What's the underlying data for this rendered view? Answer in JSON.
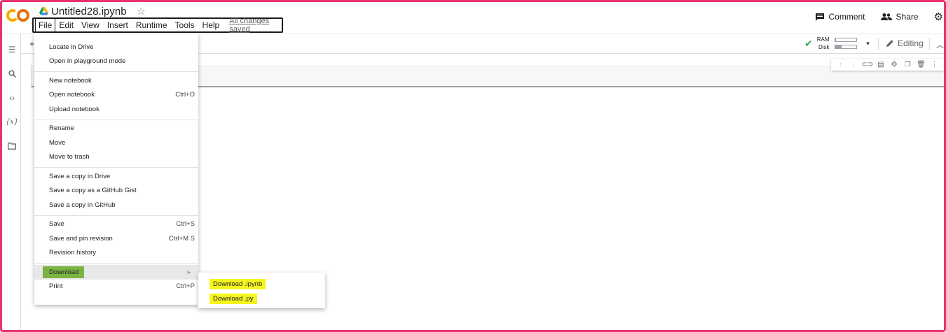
{
  "header": {
    "doc_title": "Untitled28.ipynb",
    "menu": [
      "File",
      "Edit",
      "View",
      "Insert",
      "Runtime",
      "Tools",
      "Help"
    ],
    "saved_status": "All changes saved",
    "comment_label": "Comment",
    "share_label": "Share"
  },
  "toolbar": {
    "add_symbol": "+",
    "ram_label": "RAM",
    "disk_label": "Disk",
    "ram_usage": 0.05,
    "disk_usage": 0.3,
    "editing_label": "Editing"
  },
  "file_menu": {
    "groups": [
      [
        {
          "label": "Locate in Drive",
          "shortcut": ""
        },
        {
          "label": "Open in playground mode",
          "shortcut": ""
        }
      ],
      [
        {
          "label": "New notebook",
          "shortcut": ""
        },
        {
          "label": "Open notebook",
          "shortcut": "Ctrl+O"
        },
        {
          "label": "Upload notebook",
          "shortcut": ""
        }
      ],
      [
        {
          "label": "Rename",
          "shortcut": ""
        },
        {
          "label": "Move",
          "shortcut": ""
        },
        {
          "label": "Move to trash",
          "shortcut": ""
        }
      ],
      [
        {
          "label": "Save a copy in Drive",
          "shortcut": ""
        },
        {
          "label": "Save a copy as a GitHub Gist",
          "shortcut": ""
        },
        {
          "label": "Save a copy in GitHub",
          "shortcut": ""
        }
      ],
      [
        {
          "label": "Save",
          "shortcut": "Ctrl+S"
        },
        {
          "label": "Save and pin revision",
          "shortcut": "Ctrl+M S"
        },
        {
          "label": "Revision history",
          "shortcut": ""
        }
      ],
      [
        {
          "label": "Download",
          "shortcut": "",
          "submenu": true,
          "highlighted": true
        },
        {
          "label": "Print",
          "shortcut": "Ctrl+P"
        }
      ]
    ]
  },
  "download_submenu": [
    "Download .ipynb",
    "Download .py"
  ],
  "colors": {
    "frame": "#e8336d",
    "logo_orange": "#f9ab00",
    "highlight_green": "#7cb342",
    "highlight_yellow": "#f6f61f"
  }
}
